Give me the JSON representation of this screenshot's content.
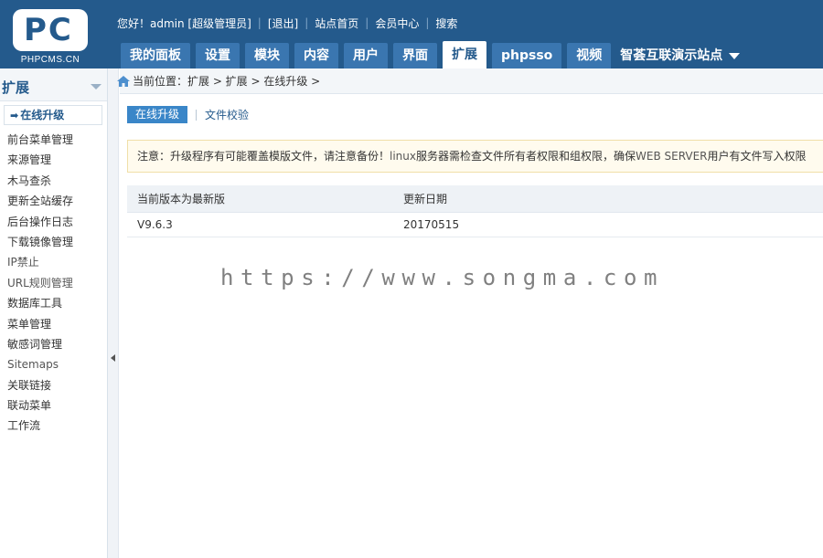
{
  "logo": {
    "mark": "PC",
    "subtitle": "PHPCMS.CN"
  },
  "toplinks": {
    "greeting": "您好！admin [超级管理员]",
    "logout": "[退出]",
    "site_home": "站点首页",
    "member_center": "会员中心",
    "search": "搜索"
  },
  "nav": {
    "tabs": [
      {
        "label": "我的面板"
      },
      {
        "label": "设置"
      },
      {
        "label": "模块"
      },
      {
        "label": "内容"
      },
      {
        "label": "用户"
      },
      {
        "label": "界面"
      },
      {
        "label": "扩展"
      },
      {
        "label": "phpsso"
      },
      {
        "label": "视频"
      }
    ],
    "active": "扩展",
    "site_selector": "智荟互联演示站点"
  },
  "sidebar": {
    "title": "扩展",
    "current": "在线升级",
    "items": [
      "前台菜单管理",
      "来源管理",
      "木马查杀",
      "更新全站缓存",
      "后台操作日志",
      "下载镜像管理",
      "IP禁止",
      "URL规则管理",
      "数据库工具",
      "菜单管理",
      "敏感词管理",
      "Sitemaps",
      "关联链接",
      "联动菜单",
      "工作流"
    ]
  },
  "breadcrumb": "当前位置：扩展 > 扩展 > 在线升级 >",
  "subtabs": {
    "online_upgrade": "在线升级",
    "file_check": "文件校验"
  },
  "notice": {
    "part1": "注意：升级程序有可能覆盖模版文件，请注意备份！",
    "part2": "linux",
    "part3": "服务器需检查文件所有者权限和组权限，确保",
    "part4": "WEB SERVER",
    "part5": "用户有文件写入权限"
  },
  "table": {
    "headers": [
      "当前版本为最新版",
      "更新日期"
    ],
    "rows": [
      [
        "V9.6.3",
        "20170515"
      ]
    ]
  },
  "watermark": "https://www.songma.com",
  "colors": {
    "header": "#245a8c",
    "tab": "#3a76b0",
    "accent": "#3a86c8",
    "notice_bg": "#fffbee"
  },
  "icons": {
    "home": "home-icon",
    "collapse": "chevron-left-icon",
    "dropdown": "chevron-down-icon"
  }
}
